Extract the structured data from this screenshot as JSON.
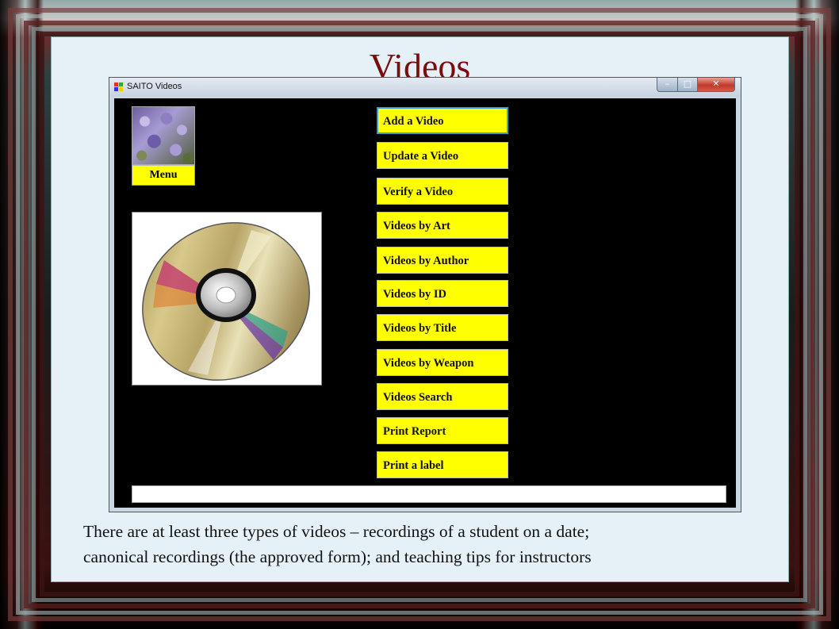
{
  "slide": {
    "title": "Videos",
    "caption_line1": "There are at least three types of videos – recordings of a student on a date;",
    "caption_line2": "canonical recordings (the approved form); and teaching tips for instructors"
  },
  "window": {
    "title": "SAITO Videos",
    "controls": {
      "minimize": "–",
      "maximize": "□",
      "close": "✕"
    }
  },
  "menu_button_label": "Menu",
  "buttons": [
    "Add a Video",
    "Update a Video",
    "Verify a Video",
    "Videos by Art",
    "Videos by Author",
    "Videos by ID",
    "Videos by Title",
    "Videos by Weapon",
    "Videos Search",
    "Print Report",
    "Print a label"
  ],
  "colors": {
    "title": "#7a0d0d",
    "button_bg": "#ffff00",
    "client_bg": "#000000",
    "focus_border": "#3aa0c8"
  }
}
